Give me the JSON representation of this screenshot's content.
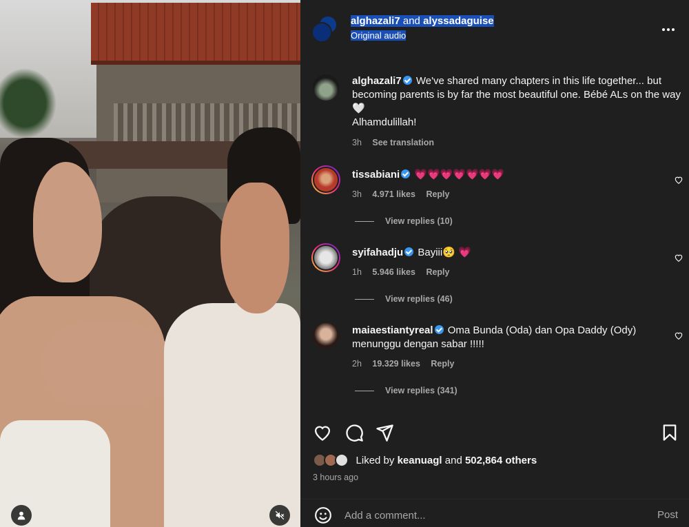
{
  "post": {
    "user1": "alghazali7",
    "and": "and",
    "user2": "alyssadaguise",
    "audio": "Original audio",
    "more_icon": "more-horizontal-icon"
  },
  "caption": {
    "user": "alghazali7",
    "text": "We've shared many chapters in this life together... but becoming parents is by far the most beautiful one. Bébé ALs on the way 🤍",
    "text2": "Alhamdulillah!",
    "time": "3h",
    "translation": "See translation"
  },
  "comments": [
    {
      "user": "tissabiani",
      "text": "💗💗💗💗💗💗💗",
      "time": "3h",
      "likes": "4.971 likes",
      "reply": "Reply",
      "replies": "View replies (10)"
    },
    {
      "user": "syifahadju",
      "text": "Bayiii🥺 💗",
      "time": "1h",
      "likes": "5.946 likes",
      "reply": "Reply",
      "replies": "View replies (46)"
    },
    {
      "user": "maiaestiantyreal",
      "text": "Oma Bunda (Oda) dan Opa Daddy (Ody) menunggu dengan sabar !!!!!",
      "time": "2h",
      "likes": "19.329 likes",
      "reply": "Reply",
      "replies": "View replies (341)"
    }
  ],
  "likes_line": {
    "prefix": "Liked by",
    "user": "keanuagl",
    "and": "and",
    "count": "502,864 others"
  },
  "post_time": "3 hours ago",
  "comment_box": {
    "placeholder": "Add a comment...",
    "post_label": "Post"
  },
  "colors": {
    "panel_bg": "#1f1f1f",
    "highlight": "#1a4fb8",
    "verified": "#3897f0",
    "muted": "#a8a8a8"
  }
}
